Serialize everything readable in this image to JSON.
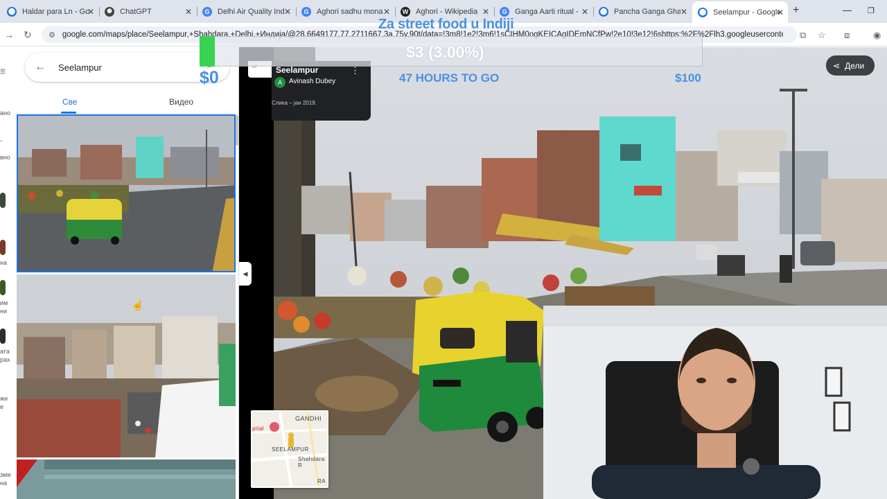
{
  "browser": {
    "tabs": [
      {
        "title": "Haldar para Ln - Go",
        "favicon": "maps-pin-icon",
        "color": "#1a73e8"
      },
      {
        "title": "ChatGPT",
        "favicon": "chatgpt-icon",
        "color": "#444444"
      },
      {
        "title": "Delhi Air Quality Ind",
        "favicon": "google-icon",
        "color": "#4285f4"
      },
      {
        "title": "Aghori sadhu monas",
        "favicon": "google-icon",
        "color": "#4285f4"
      },
      {
        "title": "Aghori - Wikipedia",
        "favicon": "wikipedia-icon",
        "color": "#222222"
      },
      {
        "title": "Ganga Aarti ritual -",
        "favicon": "google-icon",
        "color": "#4285f4"
      },
      {
        "title": "Pancha Ganga Ghat",
        "favicon": "maps-pin-icon",
        "color": "#1a73e8"
      },
      {
        "title": "Seelampur - Google",
        "favicon": "maps-pin-icon",
        "color": "#1a73e8"
      }
    ],
    "url": "google.com/maps/place/Seelampur,+Shahdara,+Delhi,+Индија/@28.6649177,77.2711667,3a,75y,90t/data=!3m8!1e2!3m6!1sCIHM0ogKEICAgIDEmNCfPw!2e10!3e12!6shttps:%2F%2Flh3.googleusercontent.c"
  },
  "maps": {
    "search_query": "Seelampur",
    "tabs": [
      "Све",
      "Видео"
    ],
    "place_name": "Seelampur",
    "author": "Avinash Dubey",
    "author_initial": "A",
    "photo_date": "Слика – јан 2019.",
    "share_label": "Дели",
    "minimap_labels": [
      "GANDHI",
      "pital",
      "SEELAMPUR",
      "Shahdara R",
      "RA"
    ],
    "edge_labels": [
      "ано",
      "вно",
      "на",
      "им",
      "ни",
      "ата",
      "рах",
      "жи",
      "е",
      "зми",
      "на"
    ]
  },
  "overlay": {
    "title": "Za street food u Indiji",
    "progress_text": "$3 (3.00%)",
    "progress_fraction": 0.03,
    "raised": "$0",
    "time_left": "47 HOURS TO GO",
    "goal": "$100",
    "accent": "#4a90e2",
    "fill_color": "#39d353"
  }
}
